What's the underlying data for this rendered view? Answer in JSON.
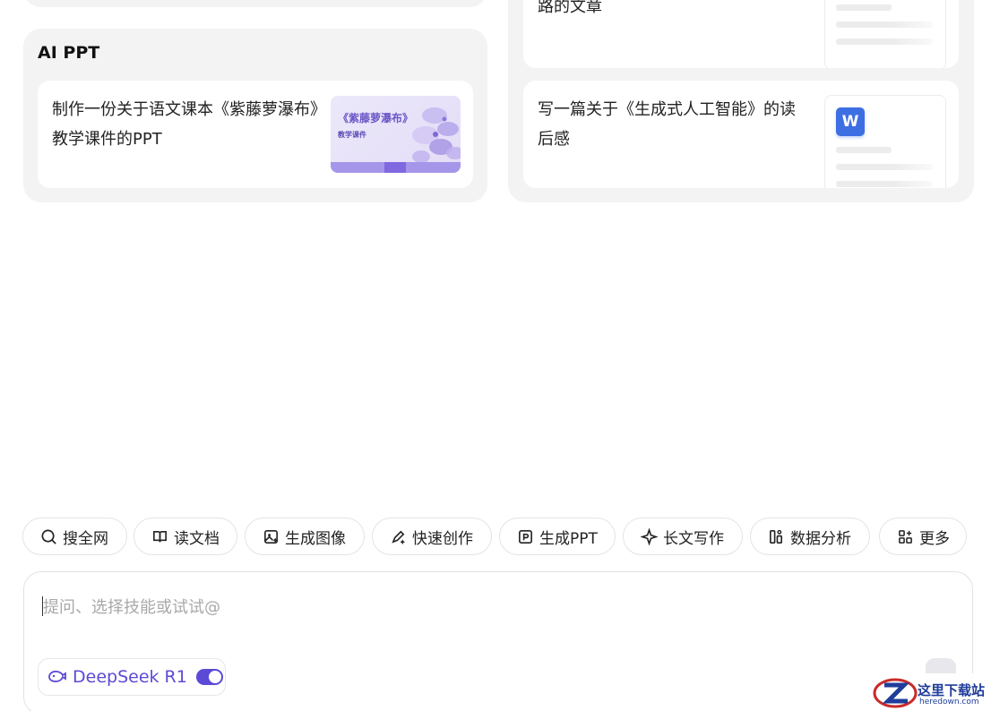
{
  "sections": {
    "ai_ppt": {
      "title": "AI PPT",
      "item_text": "制作一份关于语文课本《紫藤萝瀑布》教学课件的PPT",
      "thumb_title": "《紫藤萝瀑布》",
      "thumb_subtitle": "教学课件"
    },
    "writing": {
      "item1_text": "路的文章",
      "item2_text": "写一篇关于《生成式人工智能》的读后感",
      "doc_icon_letter": "W"
    }
  },
  "skills": [
    {
      "label": "搜全网",
      "icon": "search-icon"
    },
    {
      "label": "读文档",
      "icon": "book-icon"
    },
    {
      "label": "生成图像",
      "icon": "image-sparkle-icon"
    },
    {
      "label": "快速创作",
      "icon": "pen-sparkle-icon"
    },
    {
      "label": "生成PPT",
      "icon": "ppt-icon"
    },
    {
      "label": "长文写作",
      "icon": "sparkle-icon"
    },
    {
      "label": "数据分析",
      "icon": "chart-icon"
    },
    {
      "label": "更多",
      "icon": "grid-plus-icon"
    }
  ],
  "input": {
    "placeholder": "提问、选择技能或试试@"
  },
  "model": {
    "label": "DeepSeek R1",
    "enabled": true
  },
  "colors": {
    "accent": "#5b4ad6",
    "card_bg": "#f3f3f3",
    "word_blue": "#3d6fe3"
  },
  "watermark": {
    "title": "这里下载站",
    "domain": "heredown.com"
  }
}
